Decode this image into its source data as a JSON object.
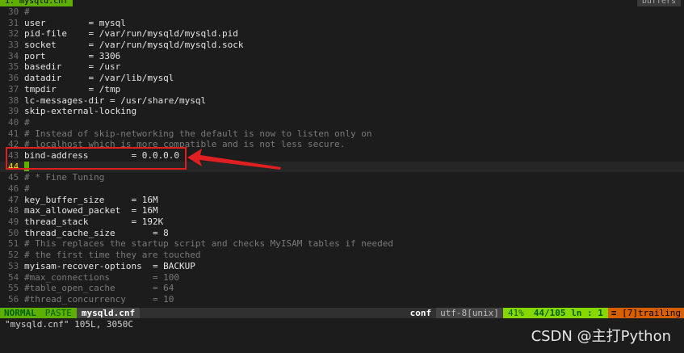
{
  "tabline": {
    "active_tab": "1. mysqld.cnf",
    "right_label": "buffers"
  },
  "lines": [
    {
      "num": "30",
      "text": "#",
      "kind": "comment"
    },
    {
      "num": "31",
      "text": "user        = mysql",
      "kind": "key"
    },
    {
      "num": "32",
      "text": "pid-file    = /var/run/mysqld/mysqld.pid",
      "kind": "key"
    },
    {
      "num": "33",
      "text": "socket      = /var/run/mysqld/mysqld.sock",
      "kind": "key"
    },
    {
      "num": "34",
      "text": "port        = 3306",
      "kind": "key"
    },
    {
      "num": "35",
      "text": "basedir     = /usr",
      "kind": "key"
    },
    {
      "num": "36",
      "text": "datadir     = /var/lib/mysql",
      "kind": "key"
    },
    {
      "num": "37",
      "text": "tmpdir      = /tmp",
      "kind": "key"
    },
    {
      "num": "38",
      "text": "lc-messages-dir = /usr/share/mysql",
      "kind": "key"
    },
    {
      "num": "39",
      "text": "skip-external-locking",
      "kind": "key"
    },
    {
      "num": "40",
      "text": "#",
      "kind": "comment"
    },
    {
      "num": "41",
      "text": "# Instead of skip-networking the default is now to listen only on",
      "kind": "comment"
    },
    {
      "num": "42",
      "text": "# localhost which is more compatible and is not less secure.",
      "kind": "comment"
    },
    {
      "num": "43",
      "text": "bind-address        = 0.0.0.0",
      "kind": "key"
    },
    {
      "num": "44",
      "text": "",
      "kind": "cursor"
    },
    {
      "num": "45",
      "text": "# * Fine Tuning",
      "kind": "comment"
    },
    {
      "num": "46",
      "text": "#",
      "kind": "comment"
    },
    {
      "num": "47",
      "text": "key_buffer_size     = 16M",
      "kind": "key"
    },
    {
      "num": "48",
      "text": "max_allowed_packet  = 16M",
      "kind": "key"
    },
    {
      "num": "49",
      "text": "thread_stack        = 192K",
      "kind": "key"
    },
    {
      "num": "50",
      "text": "thread_cache_size       = 8",
      "kind": "key"
    },
    {
      "num": "51",
      "text": "# This replaces the startup script and checks MyISAM tables if needed",
      "kind": "comment"
    },
    {
      "num": "52",
      "text": "# the first time they are touched",
      "kind": "comment"
    },
    {
      "num": "53",
      "text": "myisam-recover-options  = BACKUP",
      "kind": "key"
    },
    {
      "num": "54",
      "text": "#max_connections        = 100",
      "kind": "comment"
    },
    {
      "num": "55",
      "text": "#table_open_cache       = 64",
      "kind": "comment"
    },
    {
      "num": "56",
      "text": "#thread_concurrency     = 10",
      "kind": "comment"
    }
  ],
  "statusbar": {
    "mode": "NORMAL",
    "paste": "PASTE",
    "filename": "mysqld.cnf",
    "filetype": "conf",
    "encoding": "utf-8[unix]",
    "percent": "41%",
    "position": "44/105 ln :  1",
    "trailing": "≡ [7]trailing"
  },
  "cmdline": "\"mysqld.cnf\" 105L, 3050C",
  "watermark": "CSDN @主打Python",
  "colors": {
    "highlight": "#e02020",
    "accent": "#5faf00"
  }
}
